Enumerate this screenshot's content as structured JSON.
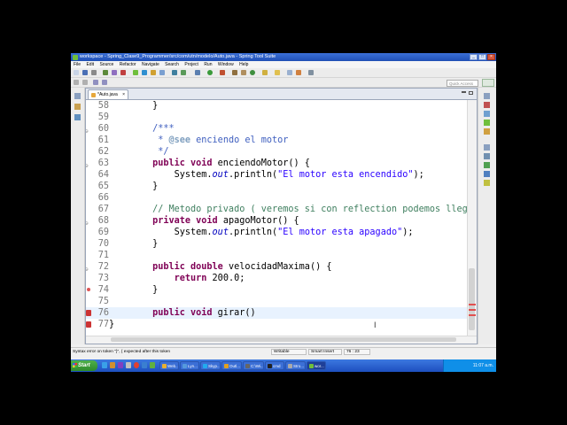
{
  "window": {
    "title": "workspace - Spring_Clase9_Programmer/src/com/utn/modelo/Auto.java - Spring Tool Suite"
  },
  "menu": [
    "File",
    "Edit",
    "Source",
    "Refactor",
    "Navigate",
    "Search",
    "Project",
    "Run",
    "Window",
    "Help"
  ],
  "quick_access": {
    "placeholder": "Quick Access"
  },
  "editor": {
    "tab_label": "*Auto.java",
    "tab_close": "×",
    "lines": [
      {
        "num": "58",
        "segs": [
          [
            "",
            "        }"
          ]
        ]
      },
      {
        "num": "59",
        "segs": [
          [
            "",
            ""
          ]
        ]
      },
      {
        "num": "60",
        "fold": true,
        "segs": [
          [
            "cm",
            "        /***"
          ]
        ]
      },
      {
        "num": "61",
        "segs": [
          [
            "cm",
            "         * "
          ],
          [
            "jd",
            "@see"
          ],
          [
            "cm",
            " enciendo el motor"
          ]
        ]
      },
      {
        "num": "62",
        "segs": [
          [
            "cm",
            "         */"
          ]
        ]
      },
      {
        "num": "63",
        "fold": true,
        "segs": [
          [
            "kw",
            "        public void "
          ],
          [
            "",
            "enciendoMotor() {"
          ]
        ]
      },
      {
        "num": "64",
        "segs": [
          [
            "",
            "            System."
          ],
          [
            "ital",
            "out"
          ],
          [
            "",
            ".println("
          ],
          [
            "str",
            "\"El motor esta encendido\""
          ],
          [
            "",
            ");"
          ]
        ]
      },
      {
        "num": "65",
        "segs": [
          [
            "",
            "        }"
          ]
        ]
      },
      {
        "num": "66",
        "segs": [
          [
            "",
            ""
          ]
        ]
      },
      {
        "num": "67",
        "segs": [
          [
            "lc",
            "        // Metodo privado ( veremos si con reflection podemos llegar mu"
          ]
        ]
      },
      {
        "num": "68",
        "fold": true,
        "segs": [
          [
            "kw",
            "        private void "
          ],
          [
            "",
            "apagoMotor() {"
          ]
        ]
      },
      {
        "num": "69",
        "segs": [
          [
            "",
            "            System."
          ],
          [
            "ital",
            "out"
          ],
          [
            "",
            ".println("
          ],
          [
            "str",
            "\"El motor esta apagado\""
          ],
          [
            "",
            ");"
          ]
        ]
      },
      {
        "num": "70",
        "segs": [
          [
            "",
            "        }"
          ]
        ]
      },
      {
        "num": "71",
        "segs": [
          [
            "",
            ""
          ]
        ]
      },
      {
        "num": "72",
        "fold": true,
        "segs": [
          [
            "kw",
            "        public double "
          ],
          [
            "",
            "velocidadMaxima() {"
          ]
        ]
      },
      {
        "num": "73",
        "segs": [
          [
            "kw",
            "            return "
          ],
          [
            "",
            "200.0;"
          ]
        ]
      },
      {
        "num": "74",
        "warn": true,
        "segs": [
          [
            "",
            "        }"
          ]
        ]
      },
      {
        "num": "75",
        "segs": [
          [
            "",
            ""
          ]
        ]
      },
      {
        "num": "76",
        "error": true,
        "current": true,
        "segs": [
          [
            "kw",
            "        public void "
          ],
          [
            "",
            "girar()"
          ]
        ]
      },
      {
        "num": "77",
        "error": true,
        "segs": [
          [
            "",
            "}"
          ]
        ]
      }
    ]
  },
  "status": {
    "message": "Syntax error on token \"}\", { expected after this token",
    "writable": "Writable",
    "insert_mode": "Smart Insert",
    "position": "76 : 23"
  },
  "taskbar": {
    "start": "Start",
    "buttons": [
      {
        "label": "Web...",
        "color": "#e8b030"
      },
      {
        "label": "Lyn...",
        "color": "#5599dd"
      },
      {
        "label": "Skyp...",
        "color": "#22aaee"
      },
      {
        "label": "Outl...",
        "color": "#e0a020"
      },
      {
        "label": "C:\\Wi...",
        "color": "#666666"
      },
      {
        "label": "cmd",
        "color": "#222222"
      },
      {
        "label": "Stro...",
        "color": "#aaaaaa"
      },
      {
        "label": "wor...",
        "color": "#6fbf3c"
      }
    ],
    "clock": "11:07 a.m."
  },
  "colors": {
    "keyword": "#7f0055",
    "comment": "#3f5fbf",
    "line_comment": "#3f7f5f",
    "string": "#2a00ff",
    "static_field": "#0000c0",
    "current_line": "#e8f2fe",
    "error": "#cc3333"
  }
}
